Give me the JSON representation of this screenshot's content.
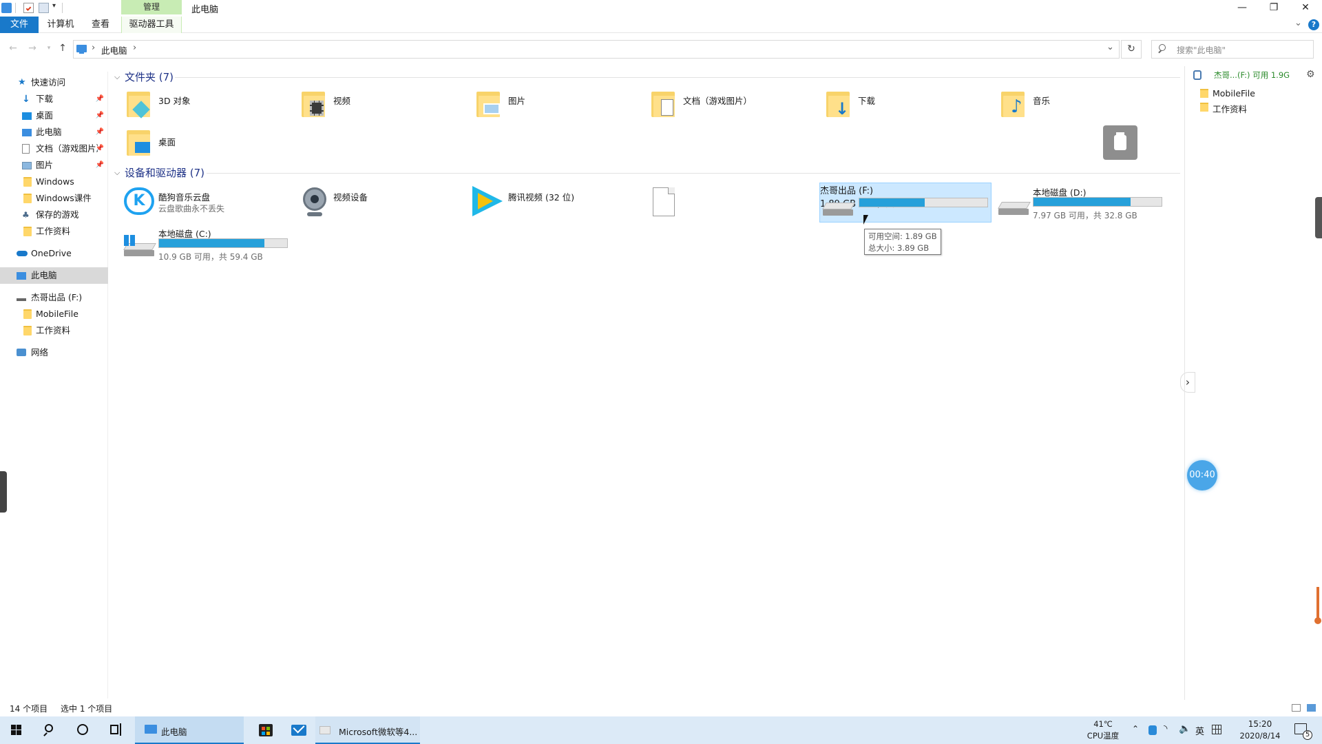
{
  "titlebar": {
    "context_tab_label": "管理",
    "window_title": "此电脑",
    "minimize": "—",
    "maximize": "❐",
    "close": "✕"
  },
  "ribbon": {
    "tabs": [
      "文件",
      "计算机",
      "查看",
      "驱动器工具"
    ],
    "collapse_glyph": "⌄",
    "help_glyph": "?"
  },
  "address": {
    "segments": [
      "此电脑"
    ],
    "sep": "›",
    "refresh_glyph": "↻",
    "dropdown_glyph": "⌄",
    "search_placeholder": "搜索\"此电脑\""
  },
  "navpane": {
    "items": [
      {
        "label": "快速访问",
        "icon": "star-icon",
        "pinned": false
      },
      {
        "label": "下载",
        "icon": "download-icon",
        "pinned": true
      },
      {
        "label": "桌面",
        "icon": "desktop-icon",
        "pinned": true
      },
      {
        "label": "此电脑",
        "icon": "computer-icon",
        "pinned": true
      },
      {
        "label": "文档（游戏图片）",
        "icon": "document-icon",
        "pinned": true
      },
      {
        "label": "图片",
        "icon": "pictures-icon",
        "pinned": true
      },
      {
        "label": "Windows",
        "icon": "folder-icon",
        "pinned": false
      },
      {
        "label": "Windows课件",
        "icon": "folder-icon",
        "pinned": false
      },
      {
        "label": "保存的游戏",
        "icon": "games-icon",
        "pinned": false
      },
      {
        "label": "工作资料",
        "icon": "folder-icon",
        "pinned": false
      },
      {
        "label": "OneDrive",
        "icon": "cloud-icon",
        "pinned": false
      },
      {
        "label": "此电脑",
        "icon": "computer-icon",
        "pinned": false
      },
      {
        "label": "杰哥出品 (F:)",
        "icon": "drive-icon",
        "pinned": false
      },
      {
        "label": "MobileFile",
        "icon": "folder-icon",
        "pinned": false
      },
      {
        "label": "工作资料",
        "icon": "folder-icon",
        "pinned": false
      },
      {
        "label": "网络",
        "icon": "network-icon",
        "pinned": false
      }
    ],
    "pin_glyph": "📌"
  },
  "content": {
    "folders_header": "文件夹 (7)",
    "folders": [
      {
        "label": "3D 对象",
        "icon": "3d-objects-icon"
      },
      {
        "label": "视频",
        "icon": "videos-icon"
      },
      {
        "label": "图片",
        "icon": "pictures-icon"
      },
      {
        "label": "文档（游戏图片）",
        "icon": "documents-icon"
      },
      {
        "label": "下载",
        "icon": "downloads-icon"
      },
      {
        "label": "音乐",
        "icon": "music-icon"
      },
      {
        "label": "桌面",
        "icon": "desktop-icon"
      }
    ],
    "devices_header": "设备和驱动器 (7)",
    "devices": [
      {
        "label": "酷狗音乐云盘",
        "sub": "云盘歌曲永不丢失",
        "icon": "kugou-icon"
      },
      {
        "label": "视频设备",
        "sub": "",
        "icon": "webcam-icon"
      },
      {
        "label": "腾讯视频 (32 位)",
        "sub": "",
        "icon": "tencent-video-icon"
      },
      {
        "label": "",
        "sub": "",
        "icon": "blank-file-icon"
      },
      {
        "label": "杰哥出品 (F:)",
        "sub": "1.89 GB 可用，共 3.89 GB",
        "icon": "removable-drive-icon",
        "used_fraction": 0.51
      },
      {
        "label": "本地磁盘 (D:)",
        "sub": "7.97 GB 可用，共 32.8 GB",
        "icon": "drive-icon",
        "used_fraction": 0.76
      },
      {
        "label": "本地磁盘 (C:)",
        "sub": "10.9 GB 可用，共 59.4 GB",
        "icon": "windows-drive-icon",
        "used_fraction": 0.82
      }
    ],
    "tooltip": {
      "line1": "可用空间: 1.89 GB",
      "line2": "总大小: 3.89 GB"
    }
  },
  "preview": {
    "header": "杰哥...(F:) 可用 1.9G",
    "items": [
      "MobileFile",
      "工作资料"
    ],
    "expand_glyph": "›",
    "timer": "00:40"
  },
  "status": {
    "count": "14 个项目",
    "selected": "选中 1 个项目"
  },
  "taskbar": {
    "apps": [
      {
        "label": "此电脑",
        "icon": "file-explorer-icon"
      },
      {
        "label": "",
        "icon": "store-icon"
      },
      {
        "label": "",
        "icon": "mail-icon"
      },
      {
        "label": "Microsoft微软等4...",
        "icon": "browser-icon"
      }
    ],
    "temp": "41℃",
    "temp_label": "CPU温度",
    "ime": "英",
    "time": "15:20",
    "date": "2020/8/14",
    "notification_count": "5"
  },
  "colors": {
    "accent": "#1979ca",
    "progress": "#26a0da",
    "selection": "#cce8ff",
    "context_tab": "#c8ecb4",
    "header_text": "#1e3287",
    "taskbar": "#dceaf7"
  }
}
